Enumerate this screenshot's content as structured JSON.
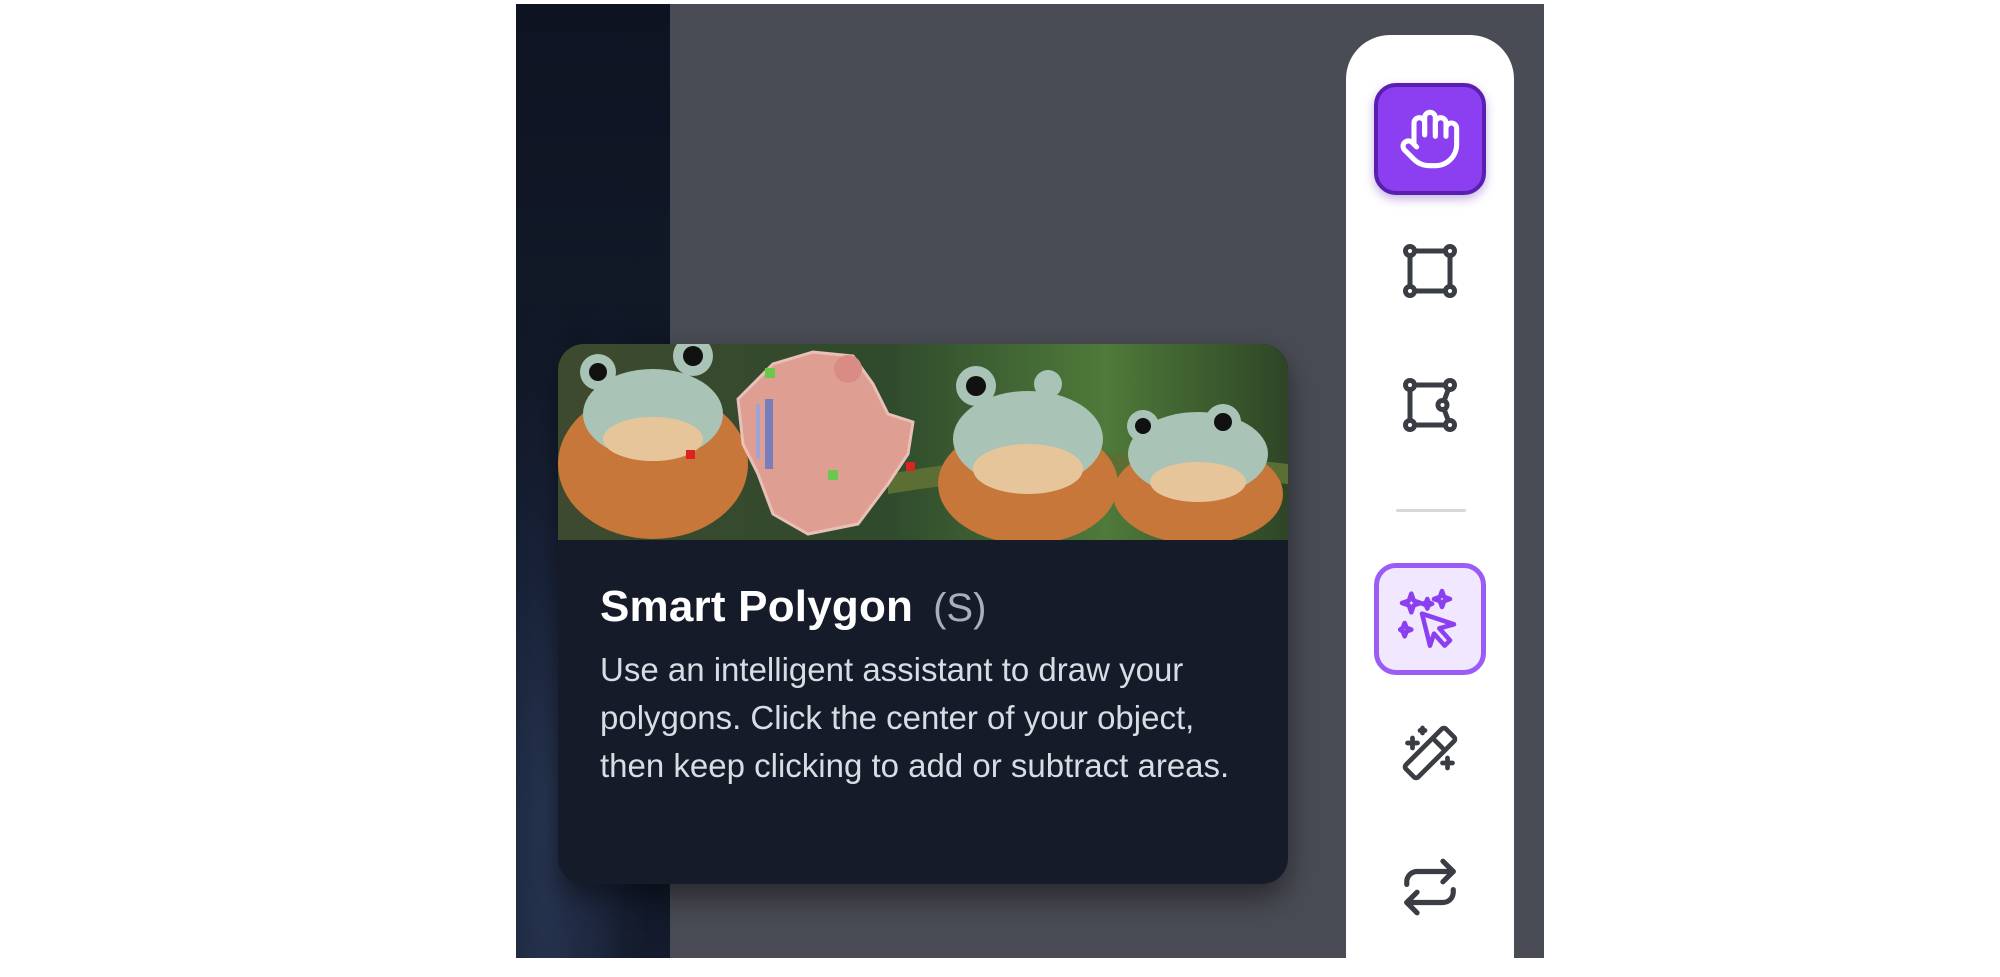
{
  "tooltip": {
    "title": "Smart Polygon",
    "shortcut": "(S)",
    "description": "Use an intelligent assistant to draw your polygons. Click the center of your object, then keep clicking to add or subtract areas."
  },
  "toolbar": {
    "tools": [
      {
        "name": "Pan",
        "icon": "hand-icon",
        "state": "selected"
      },
      {
        "name": "Bounding Box",
        "icon": "bounding-box-icon",
        "state": "default"
      },
      {
        "name": "Polygon",
        "icon": "polygon-icon",
        "state": "default"
      },
      {
        "name": "Smart Polygon",
        "icon": "sparkle-cursor-icon",
        "state": "hovered"
      },
      {
        "name": "Label Assist",
        "icon": "magic-wand-icon",
        "state": "default"
      },
      {
        "name": "Repeat Previous",
        "icon": "repeat-icon",
        "state": "default"
      }
    ]
  },
  "colors": {
    "accent": "#8b3ff0",
    "accent_dark": "#5a1fb0",
    "accent_light": "#f1e8ff",
    "canvas": "#4a4c55",
    "tooltip_bg": "#151b28"
  }
}
